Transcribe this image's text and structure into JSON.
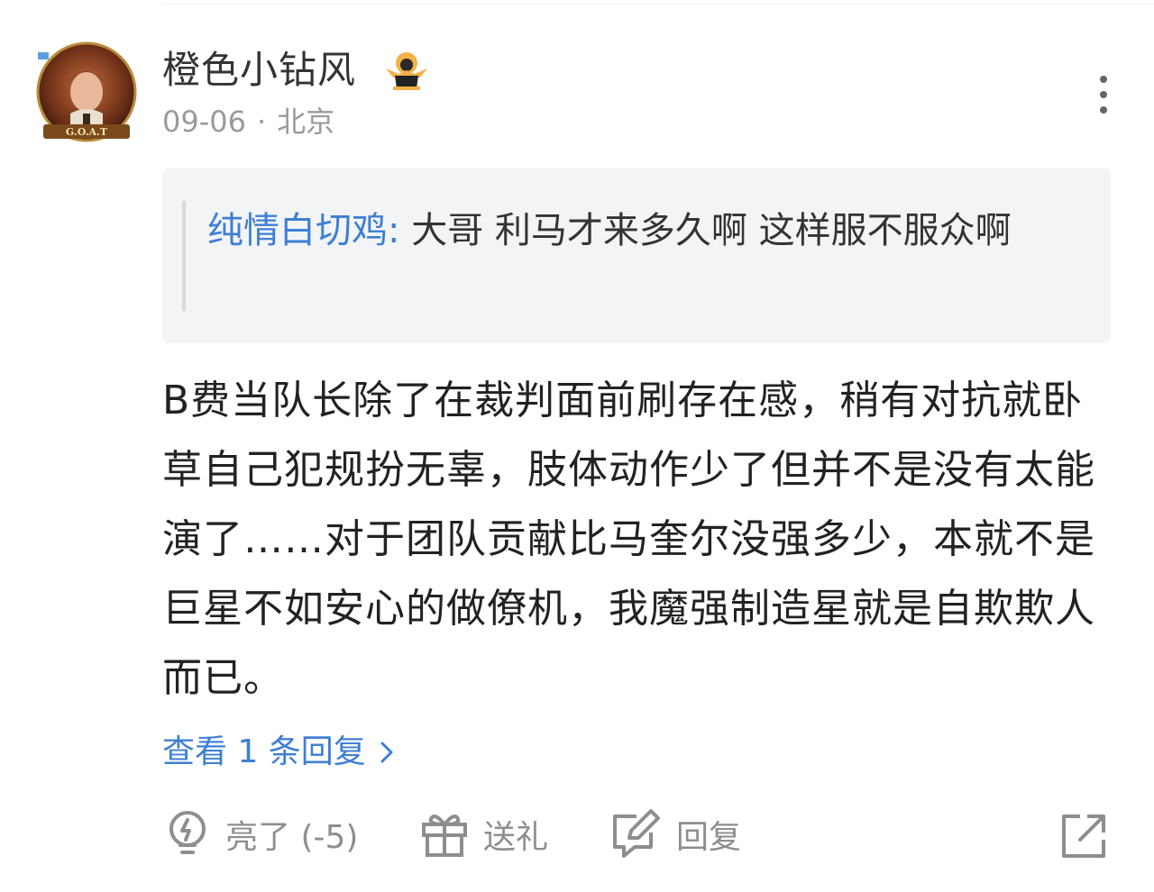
{
  "comment": {
    "username": "橙色小钻风",
    "date": "09-06",
    "separator": "·",
    "location": "北京",
    "avatar_text": "G.O.A.T",
    "quote": {
      "author": "纯情白切鸡:",
      "text": " 大哥 利马才来多久啊 这样服不服众啊"
    },
    "body": "B费当队长除了在裁判面前刷存在感，稍有对抗就卧草自己犯规扮无辜，肢体动作少了但并不是没有太能演了……对于团队贡献比马奎尔没强多少，本就不是巨星不如安心的做僚机，我魔强制造星就是自欺欺人而已。",
    "view_replies": "查看 1 条回复",
    "actions": {
      "light": "亮了 (-5)",
      "gift": "送礼",
      "reply": "回复"
    }
  },
  "colors": {
    "link_blue": "#3e7fd4",
    "quote_bg": "#f3f4f6",
    "meta_gray": "#9a9a9a",
    "icon_gray": "#8e8e8e"
  },
  "icons": [
    "avatar",
    "badge-icon",
    "more-icon",
    "chevron-right-icon",
    "lightbulb-icon",
    "gift-icon",
    "reply-icon",
    "share-icon"
  ]
}
